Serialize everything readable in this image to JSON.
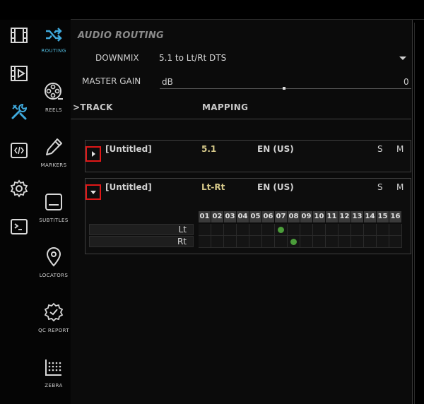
{
  "rail": {
    "icons": [
      "film-strip-icon",
      "video-player-icon",
      "tools-icon",
      "code-icon",
      "gear-icon",
      "terminal-icon"
    ],
    "active_color": "#3fa9dc"
  },
  "subnav": {
    "items": [
      {
        "label": "ROUTING",
        "icon": "shuffle-icon",
        "active": true
      },
      {
        "label": "REELS",
        "icon": "film-reel-icon"
      },
      {
        "label": "MARKERS",
        "icon": "pencil-icon"
      },
      {
        "label": "SUBTITLES",
        "icon": "subtitles-icon"
      },
      {
        "label": "LOCATORS",
        "icon": "map-pin-icon"
      },
      {
        "label": "QC REPORT",
        "icon": "badge-check-icon"
      },
      {
        "label": "ZEBRA",
        "icon": "zebra-chart-icon"
      }
    ]
  },
  "panel": {
    "title": "AUDIO ROUTING",
    "downmix_label": "DOWNMIX",
    "downmix_value": "5.1 to Lt/Rt DTS",
    "master_gain_label": "MASTER GAIN",
    "master_gain_unit": "dB",
    "master_gain_value": "0",
    "header_track": ">TRACK",
    "header_mapping": "MAPPING"
  },
  "tracks": [
    {
      "name": "[Untitled]",
      "format": "5.1",
      "language": "EN (US)",
      "solo": "S",
      "mute": "M",
      "expanded": false
    },
    {
      "name": "[Untitled]",
      "format": "Lt-Rt",
      "language": "EN (US)",
      "solo": "S",
      "mute": "M",
      "expanded": true
    }
  ],
  "matrix": {
    "channels": [
      "01",
      "02",
      "03",
      "04",
      "05",
      "06",
      "07",
      "08",
      "09",
      "10",
      "11",
      "12",
      "13",
      "14",
      "15",
      "16"
    ],
    "rows": [
      {
        "label": "Lt",
        "active_channel": "07"
      },
      {
        "label": "Rt",
        "active_channel": "08"
      }
    ],
    "dot_color": "#4b9d3a"
  }
}
